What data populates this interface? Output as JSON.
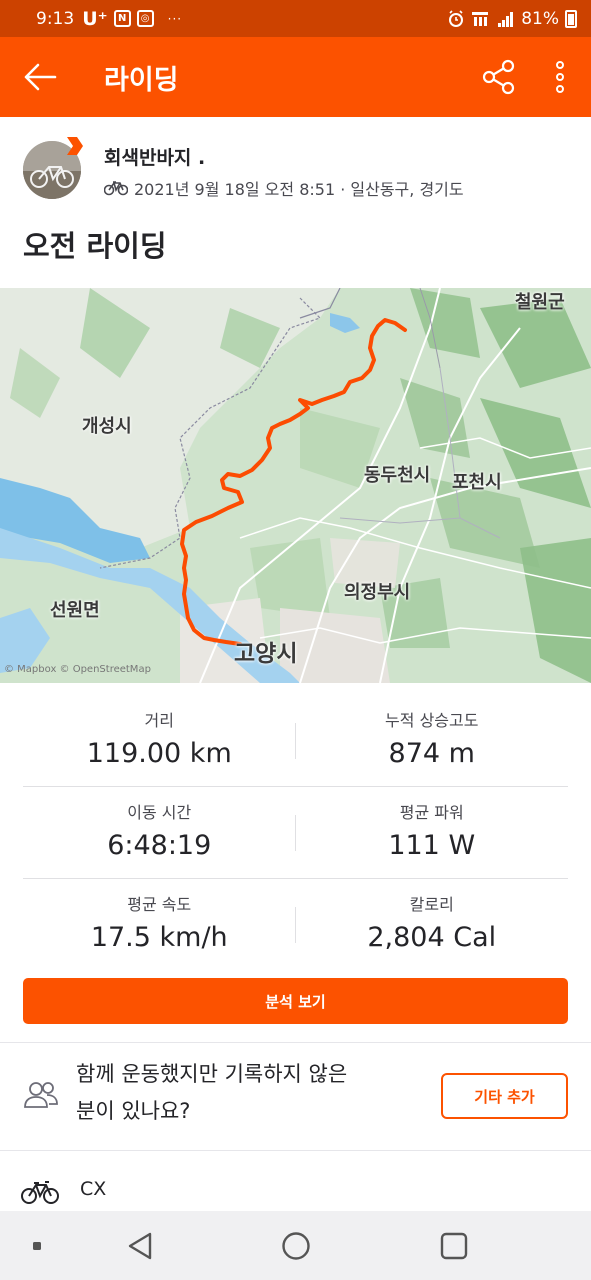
{
  "status_bar": {
    "time": "9:13",
    "carrier": "U⁺",
    "icon_n": "N",
    "dots": "···",
    "signal_label": "LTE",
    "battery": "81%"
  },
  "app_bar": {
    "title": "라이딩",
    "back_icon": "arrow-left-icon",
    "share_icon": "share-icon",
    "more_icon": "more-vertical-icon"
  },
  "activity": {
    "athlete_name": "회색반바지 .",
    "date_location": "2021년 9월 18일 오전 8:51 · 일산동구, 경기도",
    "title": "오전 라이딩",
    "sport_icon": "bike-icon"
  },
  "map": {
    "labels": {
      "cheorwon": "철원군",
      "gaeseong": "개성시",
      "dongducheon": "동두천시",
      "pocheon": "포천시",
      "uijeongbu": "의정부시",
      "seonwon": "선원면",
      "goyang": "고양시"
    },
    "attribution": "© Mapbox © OpenStreetMap",
    "route_color": "#fc4c02"
  },
  "stats": [
    {
      "label": "거리",
      "value": "119.00 km"
    },
    {
      "label": "누적 상승고도",
      "value": "874 m"
    },
    {
      "label": "이동 시간",
      "value": "6:48:19"
    },
    {
      "label": "평균 파워",
      "value": "111 W"
    },
    {
      "label": "평균 속도",
      "value": "17.5 km/h"
    },
    {
      "label": "칼로리",
      "value": "2,804 Cal"
    }
  ],
  "analyze_button": "분석 보기",
  "group": {
    "text_line1": "함께 운동했지만 기록하지 않은",
    "text_line2": "분이 있나요?",
    "button": "기타 추가"
  },
  "gear": {
    "label": "CX"
  },
  "colors": {
    "brand": "#fc5200",
    "status_bar": "#cc4200"
  }
}
